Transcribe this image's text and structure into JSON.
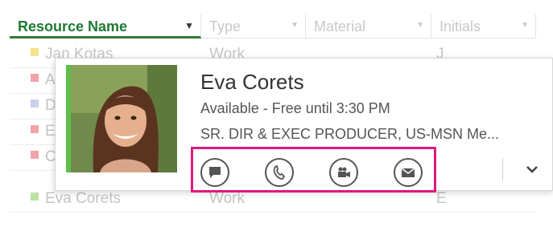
{
  "grid": {
    "columns": [
      {
        "label": "Resource Name"
      },
      {
        "label": "Type"
      },
      {
        "label": "Material"
      },
      {
        "label": "Initials"
      }
    ],
    "rows": [
      {
        "name": "Jan Kotas",
        "type": "Work",
        "initials": "J",
        "marker_color": "#f5e48a"
      },
      {
        "name": "A",
        "type": "",
        "initials": "",
        "marker_color": "#f2a3a8"
      },
      {
        "name": "D",
        "type": "",
        "initials": "",
        "marker_color": "#c9cfee"
      },
      {
        "name": "E",
        "type": "",
        "initials": "",
        "marker_color": "#f2a3a8"
      },
      {
        "name": "C",
        "type": "",
        "initials": "",
        "marker_color": "#f2a3a8"
      },
      {
        "name": "Eva Corets",
        "type": "Work",
        "initials": "E",
        "marker_color": "#b9e2a4"
      }
    ]
  },
  "contact_card": {
    "name": "Eva Corets",
    "status": "Available - Free until 3:30 PM",
    "title": "SR. DIR & EXEC PRODUCER, US-MSN Me...",
    "presence_color": "#5cbf4a",
    "actions": [
      {
        "icon": "chat-icon"
      },
      {
        "icon": "phone-icon"
      },
      {
        "icon": "video-icon"
      },
      {
        "icon": "email-icon"
      }
    ],
    "expand_icon": "chevron-down-icon"
  },
  "highlight_color": "#e0197d"
}
